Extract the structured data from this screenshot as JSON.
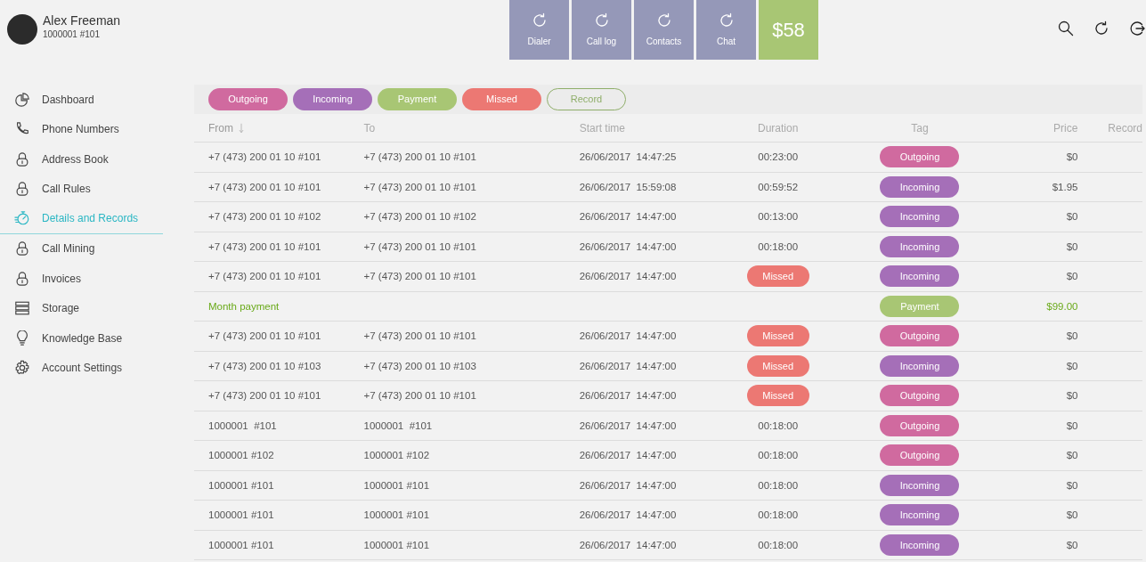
{
  "user": {
    "name": "Alex Freeman",
    "account": "1000001 #101"
  },
  "tiles": [
    {
      "kind": "action",
      "label": "Dialer"
    },
    {
      "kind": "action",
      "label": "Call log"
    },
    {
      "kind": "action",
      "label": "Contacts"
    },
    {
      "kind": "action",
      "label": "Chat"
    },
    {
      "kind": "balance",
      "label": "$58"
    }
  ],
  "sidebar": {
    "items": [
      {
        "label": "Dashboard",
        "selected": false
      },
      {
        "label": "Phone Numbers",
        "selected": false
      },
      {
        "label": "Address Book",
        "selected": false
      },
      {
        "label": "Call Rules",
        "selected": false
      },
      {
        "label": "Details and Records",
        "selected": true
      },
      {
        "label": "Call Mining",
        "selected": false
      },
      {
        "label": "Invoices",
        "selected": false
      },
      {
        "label": "Storage",
        "selected": false
      },
      {
        "label": "Knowledge Base",
        "selected": false
      },
      {
        "label": "Account Settings",
        "selected": false
      }
    ]
  },
  "filters": [
    {
      "label": "Outgoing",
      "kind": "filled",
      "color": "#d06a9f"
    },
    {
      "label": "Incoming",
      "kind": "filled",
      "color": "#a56fb8"
    },
    {
      "label": "Payment",
      "kind": "filled",
      "color": "#a8c674"
    },
    {
      "label": "Missed",
      "kind": "filled",
      "color": "#ec7873"
    },
    {
      "label": "Record",
      "kind": "outline",
      "color": "#8fae6a"
    }
  ],
  "table": {
    "columns": [
      {
        "label": "From",
        "sorted": true
      },
      {
        "label": "To",
        "sorted": false
      },
      {
        "label": "Start time",
        "sorted": false
      },
      {
        "label": "Duration",
        "sorted": false
      },
      {
        "label": "Tag",
        "sorted": false
      },
      {
        "label": "Price",
        "sorted": false
      },
      {
        "label": "Record",
        "sorted": false
      }
    ],
    "rows": [
      {
        "kind": "call",
        "from": "+7 (473) 200 01 10 #101",
        "to": "+7 (473) 200 01 10 #101",
        "start": "26/06/2017  14:47:25",
        "duration": "00:23:00",
        "missed": false,
        "tag": {
          "label": "Outgoing",
          "color": "#d06a9f"
        },
        "price": "$0"
      },
      {
        "kind": "call",
        "from": "+7 (473) 200 01 10 #101",
        "to": "+7 (473) 200 01 10 #101",
        "start": "26/06/2017  15:59:08",
        "duration": "00:59:52",
        "missed": false,
        "tag": {
          "label": "Incoming",
          "color": "#a56fb8"
        },
        "price": "$1.95"
      },
      {
        "kind": "call",
        "from": "+7 (473) 200 01 10 #102",
        "to": "+7 (473) 200 01 10 #102",
        "start": "26/06/2017  14:47:00",
        "duration": "00:13:00",
        "missed": false,
        "tag": {
          "label": "Incoming",
          "color": "#a56fb8"
        },
        "price": "$0"
      },
      {
        "kind": "call",
        "from": "+7 (473) 200 01 10 #101",
        "to": "+7 (473) 200 01 10 #101",
        "start": "26/06/2017  14:47:00",
        "duration": "00:18:00",
        "missed": false,
        "tag": {
          "label": "Incoming",
          "color": "#a56fb8"
        },
        "price": "$0"
      },
      {
        "kind": "call",
        "from": "+7 (473) 200 01 10 #101",
        "to": "+7 (473) 200 01 10 #101",
        "start": "26/06/2017  14:47:00",
        "missed": true,
        "missed_label": "Missed",
        "tag": {
          "label": "Incoming",
          "color": "#a56fb8"
        },
        "price": "$0"
      },
      {
        "kind": "payment",
        "from": "Month payment",
        "tag": {
          "label": "Payment",
          "color": "#a8c674"
        },
        "price": "$99.00"
      },
      {
        "kind": "call",
        "from": "+7 (473) 200 01 10 #101",
        "to": "+7 (473) 200 01 10 #101",
        "start": "26/06/2017  14:47:00",
        "missed": true,
        "missed_label": "Missed",
        "tag": {
          "label": "Outgoing",
          "color": "#d06a9f"
        },
        "price": "$0"
      },
      {
        "kind": "call",
        "from": "+7 (473) 200 01 10 #103",
        "to": "+7 (473) 200 01 10 #103",
        "start": "26/06/2017  14:47:00",
        "missed": true,
        "missed_label": "Missed",
        "tag": {
          "label": "Incoming",
          "color": "#a56fb8"
        },
        "price": "$0"
      },
      {
        "kind": "call",
        "from": "+7 (473) 200 01 10 #101",
        "to": "+7 (473) 200 01 10 #101",
        "start": "26/06/2017  14:47:00",
        "missed": true,
        "missed_label": "Missed",
        "tag": {
          "label": "Outgoing",
          "color": "#d06a9f"
        },
        "price": "$0"
      },
      {
        "kind": "call",
        "from": "1000001  #101",
        "to": "1000001  #101",
        "start": "26/06/2017  14:47:00",
        "duration": "00:18:00",
        "missed": false,
        "tag": {
          "label": "Outgoing",
          "color": "#d06a9f"
        },
        "price": "$0"
      },
      {
        "kind": "call",
        "from": "1000001 #102",
        "to": "1000001 #102",
        "start": "26/06/2017  14:47:00",
        "duration": "00:18:00",
        "missed": false,
        "tag": {
          "label": "Outgoing",
          "color": "#d06a9f"
        },
        "price": "$0"
      },
      {
        "kind": "call",
        "from": "1000001 #101",
        "to": "1000001 #101",
        "start": "26/06/2017  14:47:00",
        "duration": "00:18:00",
        "missed": false,
        "tag": {
          "label": "Incoming",
          "color": "#a56fb8"
        },
        "price": "$0"
      },
      {
        "kind": "call",
        "from": "1000001 #101",
        "to": "1000001 #101",
        "start": "26/06/2017  14:47:00",
        "duration": "00:18:00",
        "missed": false,
        "tag": {
          "label": "Incoming",
          "color": "#a56fb8"
        },
        "price": "$0"
      },
      {
        "kind": "call",
        "from": "1000001 #101",
        "to": "1000001 #101",
        "start": "26/06/2017  14:47:00",
        "duration": "00:18:00",
        "missed": false,
        "tag": {
          "label": "Incoming",
          "color": "#a56fb8"
        },
        "price": "$0"
      }
    ]
  }
}
